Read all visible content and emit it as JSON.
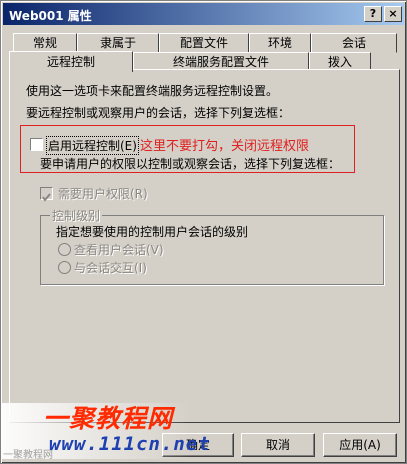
{
  "window": {
    "title": "Web001 属性",
    "help_label": "?",
    "close_label": "×"
  },
  "tabs": {
    "row_back": [
      "常规",
      "隶属于",
      "配置文件",
      "环境",
      "会话"
    ],
    "row_front": [
      "远程控制",
      "终端服务配置文件",
      "拨入"
    ],
    "active": "远程控制"
  },
  "panel": {
    "description": "使用这一选项卡来配置终端服务远程控制设置。",
    "instruction": "要远程控制或观察用户的会话，选择下列复选框：",
    "enable_remote_control": {
      "label": "启用远程控制(E)",
      "checked": false
    },
    "annotation": "这里不要打勾，关闭远程权限",
    "permission_instruction": "要申请用户的权限以控制或观察会话，选择下列复选框：",
    "require_permission": {
      "label": "需要用户权限(R)",
      "checked": true
    },
    "control_level": {
      "group_label": "控制级别",
      "instruction": "指定想要使用的控制用户会话的级别",
      "options": [
        "查看用户会话(V)",
        "与会话交互(I)"
      ]
    }
  },
  "buttons": {
    "ok": "确定",
    "cancel": "取消",
    "apply": "应用(A)"
  },
  "watermark": {
    "logo": "一聚教程网",
    "url": "www.111cn.net",
    "faint_text": "一聚教程网"
  }
}
